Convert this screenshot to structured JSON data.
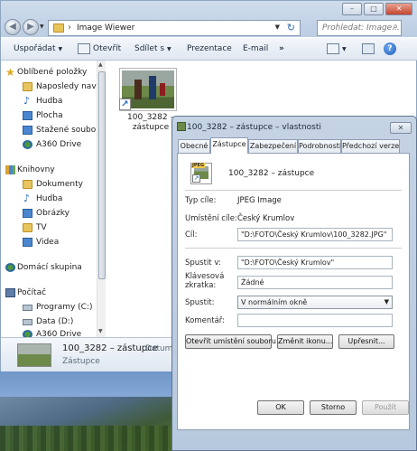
{
  "explorer": {
    "window_controls": {
      "minimize": "–",
      "maximize": "□",
      "close": "✕"
    },
    "address": "Image Wiewer",
    "search_placeholder": "Prohledat: Image...",
    "toolbar": {
      "organize": "Uspořádat",
      "open": "Otevřít",
      "share": "Sdílet s",
      "presentation": "Prezentace",
      "email": "E-mail",
      "more": "»"
    },
    "sidebar": {
      "favorites": "Oblíbené položky",
      "recent": "Naposledy navští",
      "music_fav": "Hudba",
      "desktop": "Plocha",
      "downloads": "Stažené soubory",
      "a360_fav": "A360 Drive",
      "libraries": "Knihovny",
      "documents": "Dokumenty",
      "music": "Hudba",
      "pictures": "Obrázky",
      "tv": "TV",
      "videos": "Videa",
      "homegroup": "Domácí skupina",
      "computer": "Počítač",
      "programs": "Programy (C:)",
      "data": "Data (D:)",
      "a360": "A360 Drive"
    },
    "file": {
      "name_line1": "100_3282 –",
      "name_line2": "zástupce"
    },
    "details": {
      "name": "100_3282 – zástupce",
      "type": "Zástupce",
      "date_label": "Datum"
    }
  },
  "dialog": {
    "title": "100_3282 – zástupce – vlastnosti",
    "close": "✕",
    "tabs": [
      "Obecné",
      "Zástupce",
      "Zabezpečení",
      "Podrobnosti",
      "Předchozí verze"
    ],
    "active_tab": "Zástupce",
    "icon_label": "JPEG",
    "shortcut_name": "100_3282 – zástupce",
    "labels": {
      "target_type": "Typ cíle:",
      "target_location": "Umístění cíle:",
      "target": "Cíl:",
      "start_in": "Spustit v:",
      "shortcut_key_1": "Klávesová",
      "shortcut_key_2": "zkratka:",
      "run": "Spustit:",
      "comment": "Komentář:"
    },
    "values": {
      "target_type": "JPEG Image",
      "target_location": "Český Krumlov",
      "target": "\"D:\\FOTO\\Český Krumlov\\100_3282.JPG\"",
      "start_in": "\"D:\\FOTO\\Český Krumlov\"",
      "shortcut_key": "Žádné",
      "run": "V normálním okně",
      "comment": ""
    },
    "buttons": {
      "open_location": "Otevřít umístění souboru",
      "change_icon": "Změnit ikonu...",
      "advanced": "Upřesnit...",
      "ok": "OK",
      "cancel": "Storno",
      "apply": "Použít"
    }
  }
}
